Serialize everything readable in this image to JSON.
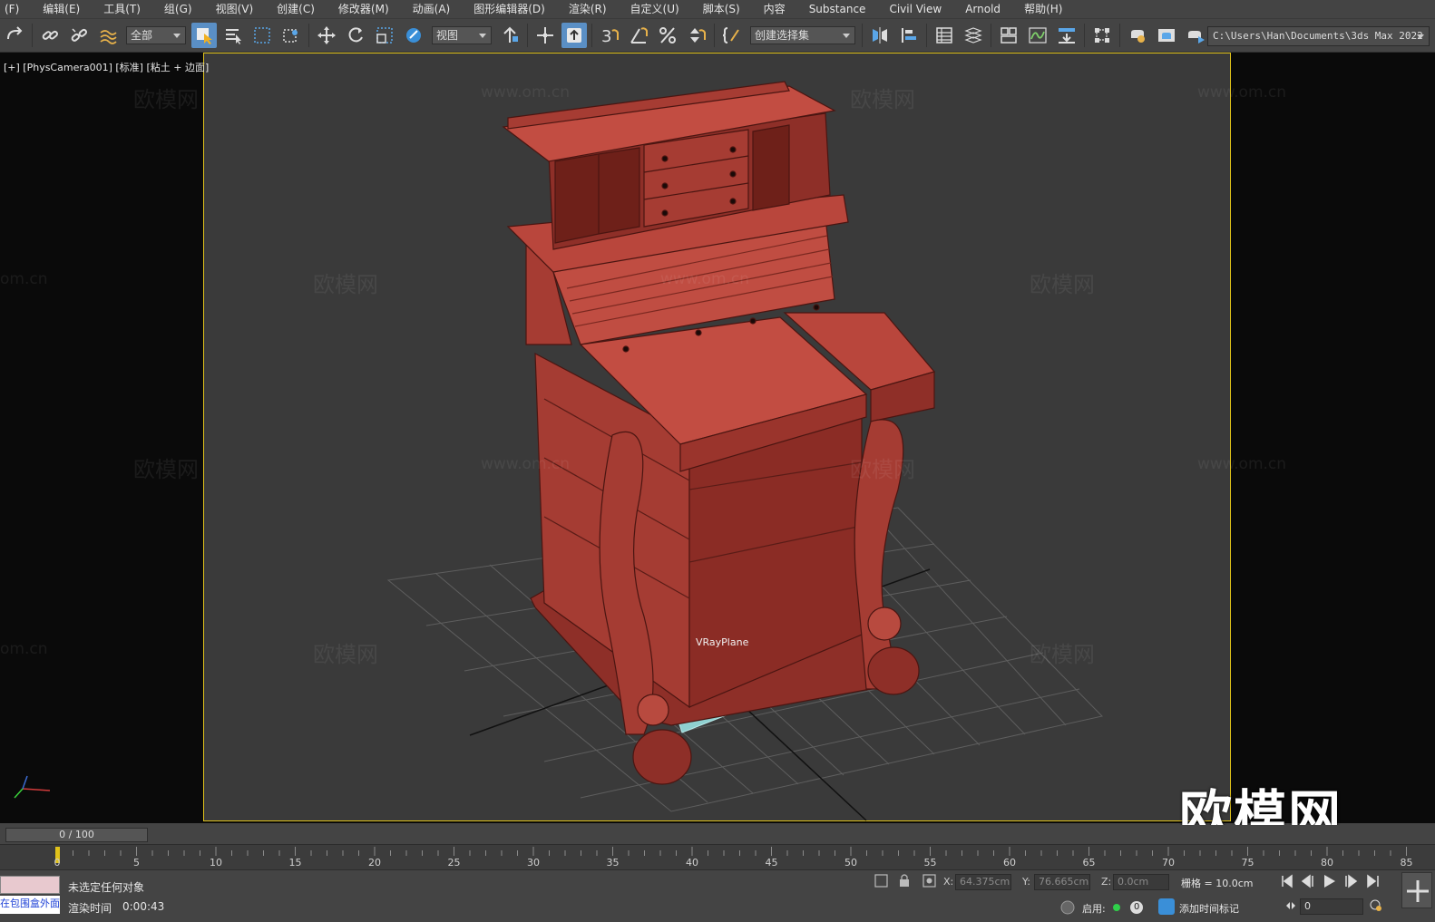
{
  "menu": [
    "(F)",
    "编辑(E)",
    "工具(T)",
    "组(G)",
    "视图(V)",
    "创建(C)",
    "修改器(M)",
    "动画(A)",
    "图形编辑器(D)",
    "渲染(R)",
    "自定义(U)",
    "脚本(S)",
    "内容",
    "Substance",
    "Civil View",
    "Arnold",
    "帮助(H)"
  ],
  "toolbar": {
    "filter_value": "全部",
    "coord_system_value": "视图",
    "named_selection_value": "创建选择集",
    "project_path": "C:\\Users\\Han\\Documents\\3ds Max 2022",
    "angle_snap_label": "3"
  },
  "viewport": {
    "label": "[+] [PhysCamera001] [标准] [粘土 + 边面]",
    "object_label": "VRayPlane",
    "watermark_text": "欧模网",
    "watermark_url": "www.om.cn",
    "watermark_url_partial": "om.cn",
    "logo_text": "欧模网",
    "model_color": "#b84a3f",
    "frame_color": "#e0c21a"
  },
  "timeline": {
    "frame_display": "0 / 100",
    "ticks": [
      "0",
      "5",
      "10",
      "15",
      "20",
      "25",
      "30",
      "35",
      "40",
      "45",
      "50",
      "55",
      "60",
      "65",
      "70",
      "75",
      "80",
      "85"
    ]
  },
  "status": {
    "selection_status": "未选定任何对象",
    "render_time_label": "渲染时间",
    "render_time_value": "0:00:43",
    "maxscript_text": "在包围盒外面",
    "x_label": "X:",
    "x_value": "64.375cm",
    "y_label": "Y:",
    "y_value": "76.665cm",
    "z_label": "Z:",
    "z_value": "0.0cm",
    "grid_text": "栅格 = 10.0cm",
    "enable_label": "启用:",
    "enable_count": "0",
    "add_time_tag": "添加时间标记",
    "frame_spinner": "0"
  }
}
